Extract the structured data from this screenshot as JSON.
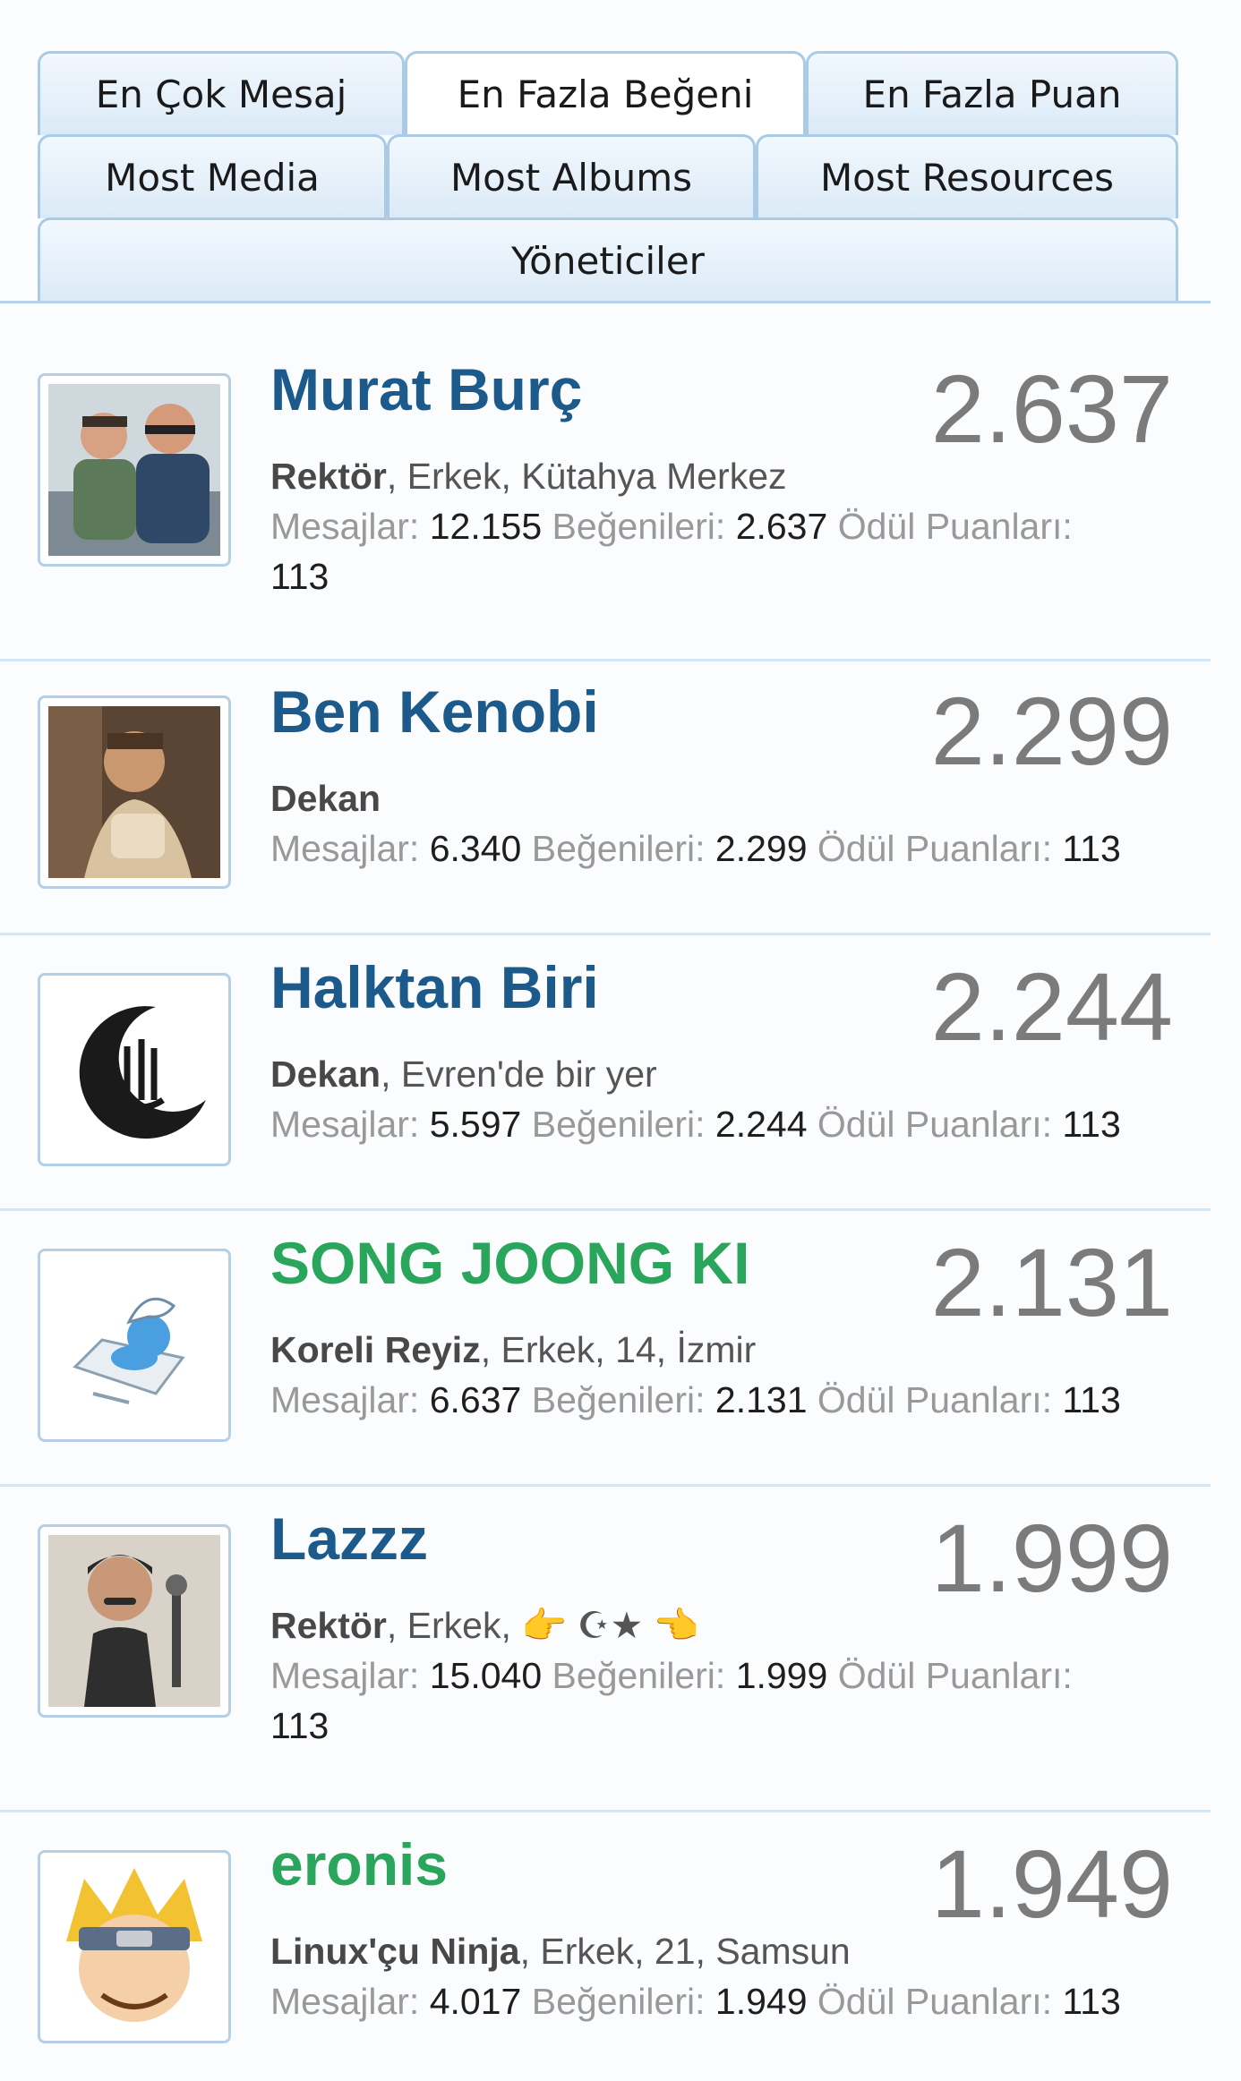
{
  "tabs": [
    {
      "label": "En Çok Mesaj",
      "active": false
    },
    {
      "label": "En Fazla Beğeni",
      "active": true
    },
    {
      "label": "En Fazla Puan",
      "active": false
    },
    {
      "label": "Most Media",
      "active": false
    },
    {
      "label": "Most Albums",
      "active": false
    },
    {
      "label": "Most Resources",
      "active": false
    },
    {
      "label": "Yöneticiler",
      "active": false
    }
  ],
  "stat_labels": {
    "messages": "Mesajlar:",
    "likes": "Beğenileri:",
    "points": "Ödül Puanları:"
  },
  "members": [
    {
      "name": "Murat Burç",
      "name_color": "#1c5a8c",
      "title": "Rektör",
      "details": ", Erkek, Kütahya Merkez",
      "messages": "12.155",
      "likes": "2.637",
      "points": "113",
      "score": "2.637",
      "avatar_icon": "two-men-photo"
    },
    {
      "name": "Ben Kenobi",
      "name_color": "#1c5a8c",
      "title": "Dekan",
      "details": "",
      "messages": "6.340",
      "likes": "2.299",
      "points": "113",
      "score": "2.299",
      "avatar_icon": "man-photo"
    },
    {
      "name": "Halktan Biri",
      "name_color": "#1c5a8c",
      "title": "Dekan",
      "details": ", Evren'de bir yer",
      "messages": "5.597",
      "likes": "2.244",
      "points": "113",
      "score": "2.244",
      "avatar_icon": "crescent-calligraphy"
    },
    {
      "name": "SONG JOONG KI",
      "name_color": "#2aa65c",
      "title": "Koreli Reyiz",
      "details": ", Erkek, 14, İzmir",
      "messages": "6.637",
      "likes": "2.131",
      "points": "113",
      "score": "2.131",
      "avatar_icon": "smurf-drawing"
    },
    {
      "name": "Lazzz",
      "name_color": "#1c5a8c",
      "title": "Rektör",
      "details": ", Erkek, 👉 ☪★ 👈",
      "messages": "15.040",
      "likes": "1.999",
      "points": "113",
      "score": "1.999",
      "avatar_icon": "caricature-singer"
    },
    {
      "name": "eronis",
      "name_color": "#2aa65c",
      "title": "Linux'çu Ninja",
      "details": ", Erkek, 21, Samsun",
      "messages": "4.017",
      "likes": "1.949",
      "points": "113",
      "score": "1.949",
      "avatar_icon": "anime-ninja"
    }
  ]
}
